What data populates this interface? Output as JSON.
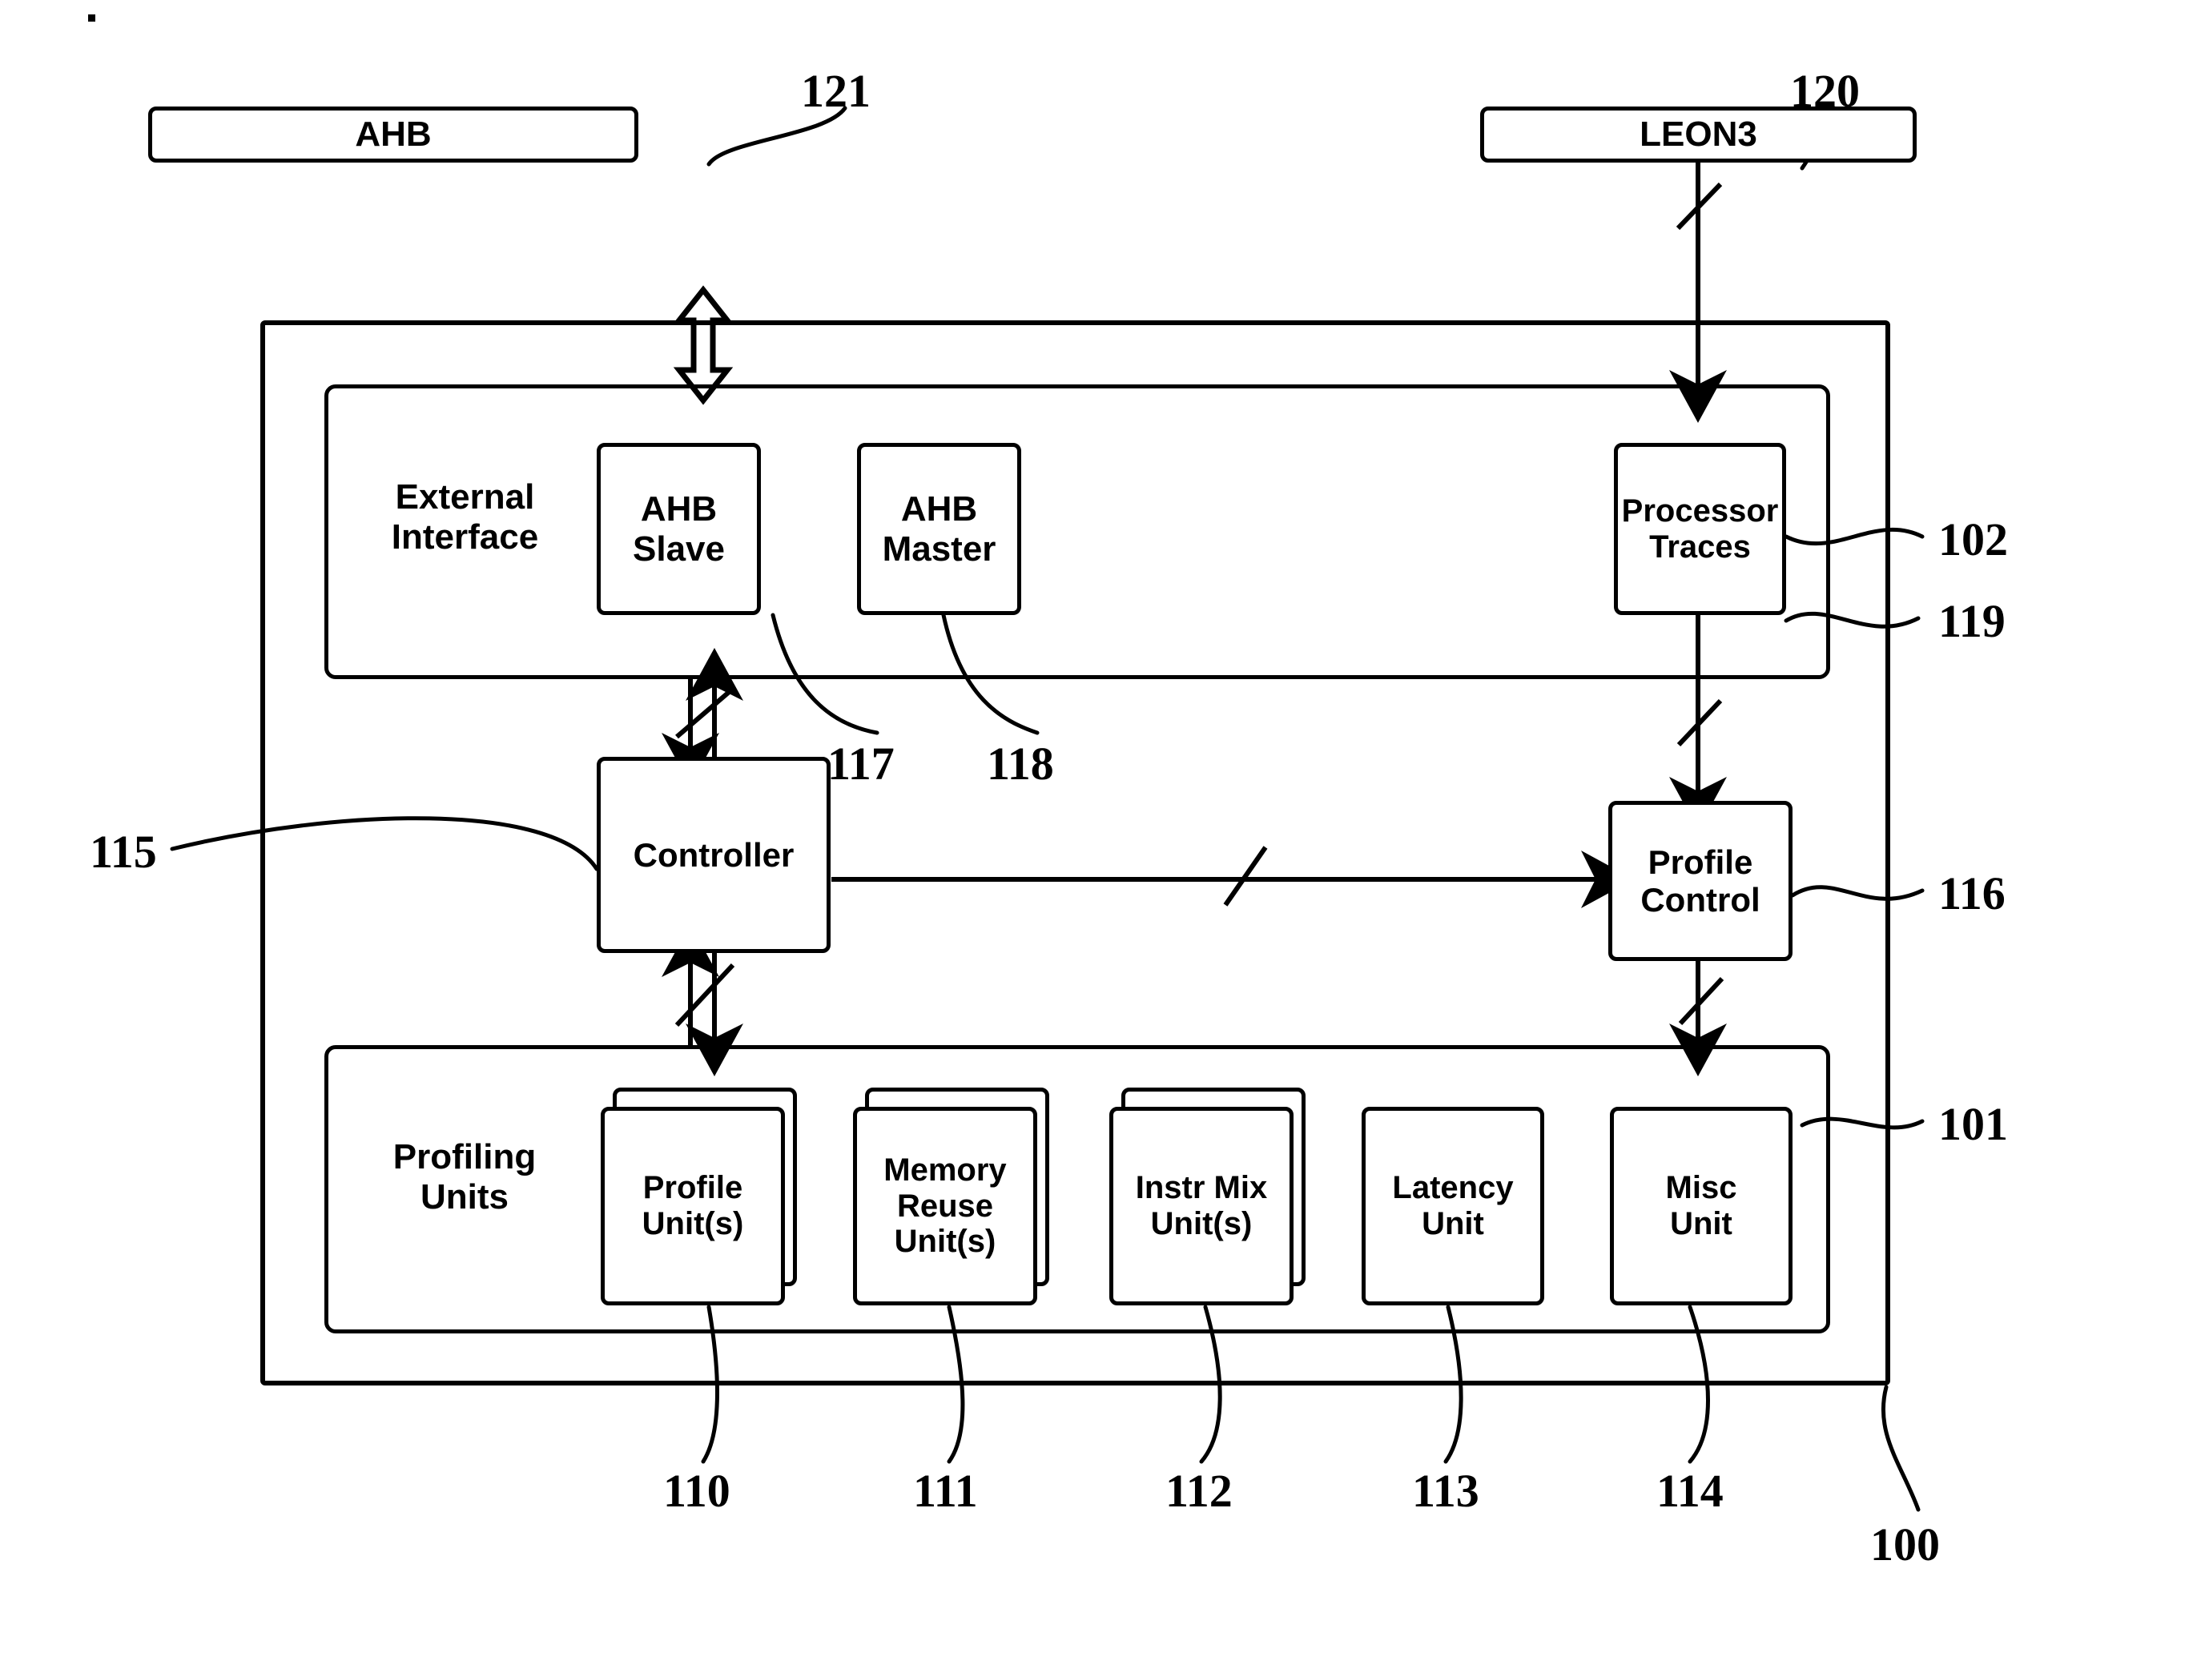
{
  "figure": {
    "type": "patent-block-diagram",
    "title": "Hardware profiling unit block diagram"
  },
  "external_blocks": [
    {
      "id": "ahb-bus",
      "label": "AHB",
      "ref": "121"
    },
    {
      "id": "leon3-cpu",
      "label": "LEON3",
      "ref": "120"
    }
  ],
  "containers": [
    {
      "id": "system",
      "label": "",
      "ref": "100"
    },
    {
      "id": "external-interface",
      "label": "External\nInterface",
      "ref": "102"
    },
    {
      "id": "profiling-units",
      "label": "Profiling\nUnits",
      "ref": "101"
    }
  ],
  "interface_blocks": [
    {
      "id": "ahb-slave",
      "label": "AHB\nSlave",
      "ref": "117",
      "stacked": false
    },
    {
      "id": "ahb-master",
      "label": "AHB\nMaster",
      "ref": "118",
      "stacked": false
    },
    {
      "id": "processor-traces",
      "label": "Processor\nTraces",
      "ref": "119",
      "stacked": false
    }
  ],
  "control_blocks": [
    {
      "id": "controller",
      "label": "Controller",
      "ref": "115"
    },
    {
      "id": "profile-control",
      "label": "Profile\nControl",
      "ref": "116"
    }
  ],
  "profiling_units": [
    {
      "id": "profile-unit",
      "label": "Profile\nUnit(s)",
      "ref": "110",
      "stacked": true
    },
    {
      "id": "memory-reuse-unit",
      "label": "Memory\nReuse\nUnit(s)",
      "ref": "111",
      "stacked": true
    },
    {
      "id": "instr-mix-unit",
      "label": "Instr Mix\nUnit(s)",
      "ref": "112",
      "stacked": true
    },
    {
      "id": "latency-unit",
      "label": "Latency\nUnit",
      "ref": "113",
      "stacked": false
    },
    {
      "id": "misc-unit",
      "label": "Misc\nUnit",
      "ref": "114",
      "stacked": false
    }
  ],
  "labels": {
    "external_interface": "External Interface",
    "external_interface_l1": "External",
    "external_interface_l2": "Interface",
    "profiling_units": "Profiling Units",
    "profiling_units_l1": "Profiling",
    "profiling_units_l2": "Units",
    "ahb": "AHB",
    "leon3": "LEON3",
    "ahb_slave_l1": "AHB",
    "ahb_slave_l2": "Slave",
    "ahb_master_l1": "AHB",
    "ahb_master_l2": "Master",
    "processor_traces_l1": "Processor",
    "processor_traces_l2": "Traces",
    "controller": "Controller",
    "profile_control_l1": "Profile",
    "profile_control_l2": "Control",
    "profile_unit_l1": "Profile",
    "profile_unit_l2": "Unit(s)",
    "memory_reuse_l1": "Memory",
    "memory_reuse_l2": "Reuse",
    "memory_reuse_l3": "Unit(s)",
    "instr_mix_l1": "Instr Mix",
    "instr_mix_l2": "Unit(s)",
    "latency_l1": "Latency",
    "latency_l2": "Unit",
    "misc_l1": "Misc",
    "misc_l2": "Unit"
  },
  "reference_numerals": {
    "n100": "100",
    "n101": "101",
    "n102": "102",
    "n110": "110",
    "n111": "111",
    "n112": "112",
    "n113": "113",
    "n114": "114",
    "n115": "115",
    "n116": "116",
    "n117": "117",
    "n118": "118",
    "n119": "119",
    "n120": "120",
    "n121": "121"
  },
  "colors": {
    "ink": "#000000",
    "paper": "#ffffff"
  }
}
